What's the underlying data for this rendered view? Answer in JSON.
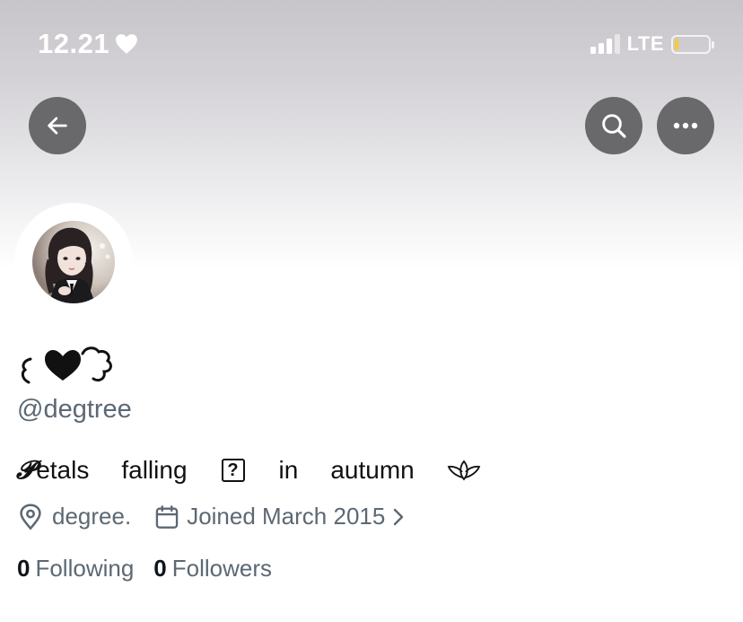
{
  "status_bar": {
    "time": "12.21",
    "network": "LTE",
    "battery_level": 0.12,
    "battery_color": "#f3cd3a"
  },
  "header": {
    "back_icon": "arrow-left-icon",
    "search_icon": "search-icon",
    "more_icon": "ellipsis-icon",
    "button_color": "#69686b"
  },
  "profile": {
    "display_name": "₍🖤₎",
    "handle": "@degtree",
    "bio": {
      "first_letter": "𝓟",
      "words": [
        "etals",
        "falling",
        "?",
        "in",
        "autumn"
      ],
      "trailing_icon": "lotus-icon"
    },
    "location": "degree.",
    "joined": "Joined March 2015",
    "following_count": "0",
    "following_label": "Following",
    "followers_count": "0",
    "followers_label": "Followers"
  },
  "colors": {
    "secondary_text": "#5c6874",
    "primary_text": "#0f1419"
  }
}
